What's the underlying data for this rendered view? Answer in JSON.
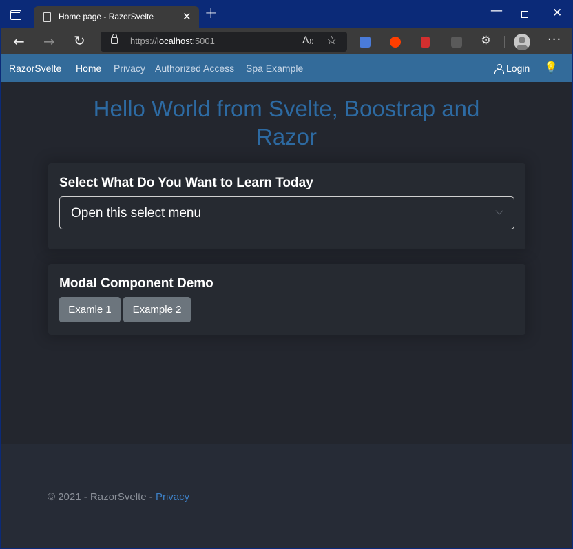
{
  "browser": {
    "tab_title": "Home page - RazorSvelte",
    "url_scheme": "https://",
    "url_host": "localhost",
    "url_port": ":5001"
  },
  "navbar": {
    "brand": "RazorSvelte",
    "links": [
      "Home",
      "Privacy",
      "Authorized Access",
      "Spa Example"
    ],
    "active": "Home",
    "login": "Login",
    "color": "#336b9a"
  },
  "hero": {
    "line1": "Hello World from Svelte, Boostrap and",
    "line2": "Razor",
    "color": "#2d6aa2"
  },
  "learn_card": {
    "title": "Select What Do You Want to Learn Today",
    "select_value": "Open this select menu"
  },
  "modal_card": {
    "title": "Modal Component Demo",
    "buttons": [
      "Examle 1",
      "Example 2"
    ]
  },
  "footer": {
    "text": "© 2021 - RazorSvelte - ",
    "link": "Privacy"
  }
}
